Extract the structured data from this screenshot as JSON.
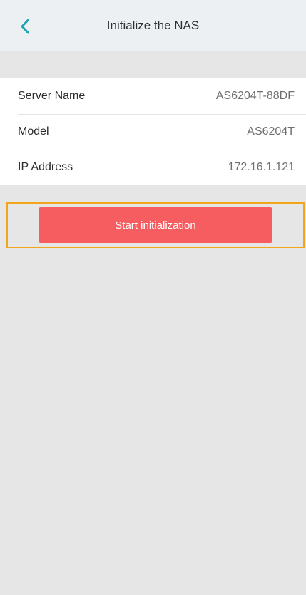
{
  "header": {
    "title": "Initialize the NAS",
    "back_icon": "chevron-left-icon",
    "back_color": "#1fa3b2"
  },
  "info": {
    "rows": [
      {
        "label": "Server Name",
        "value": "AS6204T-88DF"
      },
      {
        "label": "Model",
        "value": "AS6204T"
      },
      {
        "label": "IP Address",
        "value": "172.16.1.121"
      }
    ]
  },
  "actions": {
    "start_label": "Start initialization",
    "button_color": "#f65d60",
    "highlight_color": "#f0a51a"
  }
}
